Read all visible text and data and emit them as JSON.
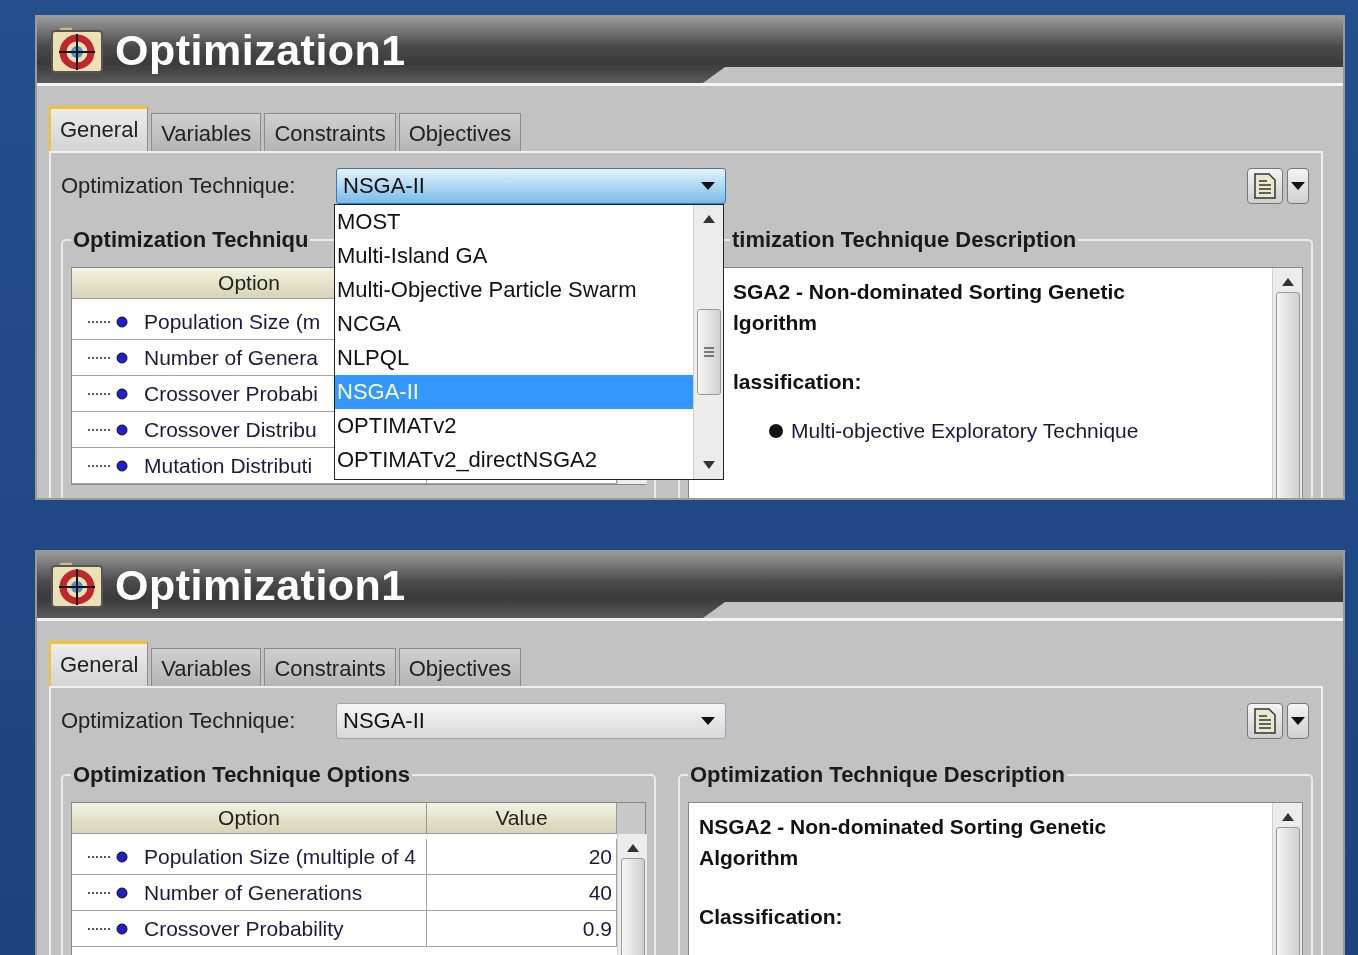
{
  "panels": [
    {
      "window": {
        "title": "Optimization1"
      },
      "tabs": [
        {
          "label": "General",
          "selected": true
        },
        {
          "label": "Variables",
          "selected": false
        },
        {
          "label": "Constraints",
          "selected": false
        },
        {
          "label": "Objectives",
          "selected": false
        }
      ],
      "technique": {
        "label": "Optimization Technique:",
        "value": "NSGA-II",
        "expanded": true,
        "options": [
          {
            "label": "MOST",
            "selected": false
          },
          {
            "label": "Multi-Island GA",
            "selected": false
          },
          {
            "label": "Multi-Objective Particle Swarm",
            "selected": false
          },
          {
            "label": "NCGA",
            "selected": false
          },
          {
            "label": "NLPQL",
            "selected": false
          },
          {
            "label": "NSGA-II",
            "selected": true
          },
          {
            "label": "OPTIMATv2",
            "selected": false
          },
          {
            "label": "OPTIMATv2_directNSGA2",
            "selected": false
          }
        ]
      },
      "options_group": {
        "title": "Optimization Techniqu",
        "columns": [
          "Option"
        ],
        "rows": [
          {
            "option": "Population Size (m"
          },
          {
            "option": "Number of Genera"
          },
          {
            "option": "Crossover Probabi"
          },
          {
            "option": "Crossover Distribu"
          },
          {
            "option": "Mutation Distributi"
          }
        ]
      },
      "description_group": {
        "title": "timization Technique Description",
        "heading_lines": [
          "SGA2 - Non-dominated Sorting Genetic",
          "lgorithm"
        ],
        "classification_label": "lassification:",
        "bullets": [
          "Multi-objective Exploratory Technique"
        ]
      }
    },
    {
      "window": {
        "title": "Optimization1"
      },
      "tabs": [
        {
          "label": "General",
          "selected": true
        },
        {
          "label": "Variables",
          "selected": false
        },
        {
          "label": "Constraints",
          "selected": false
        },
        {
          "label": "Objectives",
          "selected": false
        }
      ],
      "technique": {
        "label": "Optimization Technique:",
        "value": "NSGA-II",
        "expanded": false
      },
      "options_group": {
        "title": "Optimization Technique Options",
        "columns": [
          "Option",
          "Value"
        ],
        "rows": [
          {
            "option": "Population Size (multiple of 4",
            "value": "20"
          },
          {
            "option": "Number of Generations",
            "value": "40"
          },
          {
            "option": "Crossover Probability",
            "value": "0.9"
          }
        ]
      },
      "description_group": {
        "title": "Optimization Technique Description",
        "heading_lines": [
          "NSGA2 - Non-dominated Sorting Genetic",
          "Algorithm"
        ],
        "classification_label": "Classification:"
      }
    }
  ]
}
